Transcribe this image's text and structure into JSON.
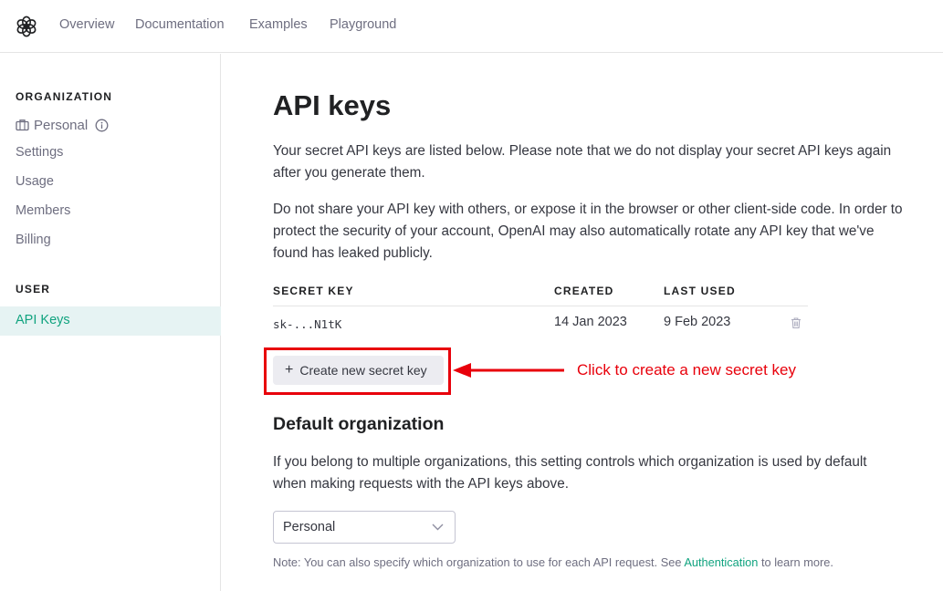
{
  "nav": {
    "items": [
      {
        "label": "Overview"
      },
      {
        "label": "Documentation"
      },
      {
        "label": "Examples"
      },
      {
        "label": "Playground"
      }
    ]
  },
  "sidebar": {
    "org_heading": "ORGANIZATION",
    "org_name": "Personal",
    "org_items": [
      {
        "label": "Settings"
      },
      {
        "label": "Usage"
      },
      {
        "label": "Members"
      },
      {
        "label": "Billing"
      }
    ],
    "user_heading": "USER",
    "user_items": [
      {
        "label": "API Keys",
        "active": true
      }
    ]
  },
  "main": {
    "title": "API keys",
    "intro_lines": [
      "Your secret API keys are listed below. Please note that we do not display your secret API keys again",
      "after you generate them."
    ],
    "warning_lines": [
      "Do not share your API key with others, or expose it in the browser or other client-side code. In order to",
      "protect the security of your account, OpenAI may also automatically rotate any API key that we've",
      "found has leaked publicly."
    ],
    "table": {
      "headers": [
        "SECRET KEY",
        "CREATED",
        "LAST USED"
      ],
      "rows": [
        {
          "key": "sk-...N1tK",
          "created": "14 Jan 2023",
          "last_used": "9 Feb 2023"
        }
      ]
    },
    "create_button": "Create new secret key",
    "annotation": "Click to create a new secret key",
    "default_org": {
      "heading": "Default organization",
      "lines": [
        "If you belong to multiple organizations, this setting controls which organization is used by default",
        "when making requests with the API keys above."
      ],
      "selected": "Personal",
      "note_prefix": "Note: You can also specify which organization to use for each API request. See ",
      "note_link": "Authentication",
      "note_suffix": " to learn more."
    }
  },
  "colors": {
    "accent": "#10a37f",
    "annotation": "#e8000b",
    "active_bg": "#e6f3f3",
    "button_bg": "#ececf1"
  },
  "icons": {
    "logo": "openai-logo-icon",
    "org": "briefcase-icon",
    "info": "info-icon",
    "trash": "trash-icon",
    "plus": "plus-icon",
    "chevron": "chevron-down-icon"
  }
}
